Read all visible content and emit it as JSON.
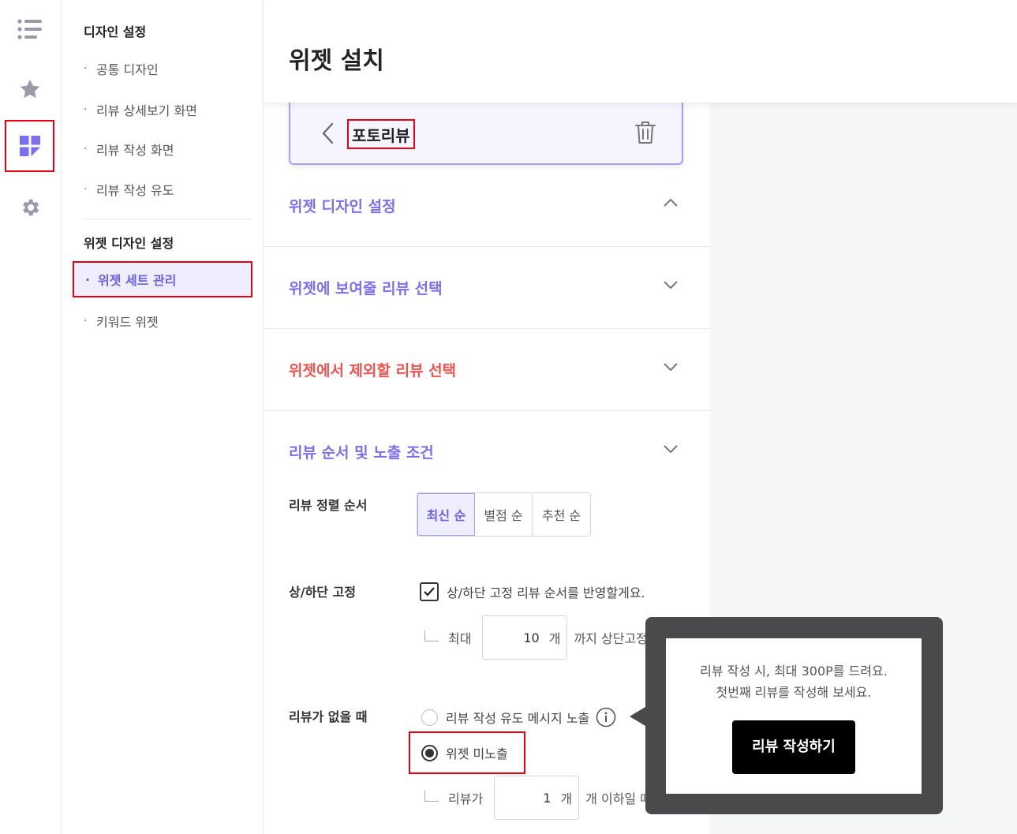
{
  "rail": {
    "icons": [
      "list-icon",
      "star-icon",
      "dashboard-icon",
      "gear-icon"
    ],
    "accent": "#7a6ff0"
  },
  "submenu": {
    "design_heading": "디자인 설정",
    "design_items": [
      "공통 디자인",
      "리뷰 상세보기 화면",
      "리뷰 작성 화면",
      "리뷰 작성 유도"
    ],
    "widget_heading": "위젯 디자인 설정",
    "widget_items": [
      "위젯 세트 관리",
      "키워드 위젯"
    ]
  },
  "header": {
    "title": "위젯 설치"
  },
  "widget_card": {
    "name": "포토리뷰"
  },
  "sections": [
    {
      "title": "위젯 디자인 설정",
      "expanded": true
    },
    {
      "title": "위젯에 보여줄 리뷰 선택",
      "expanded": false
    },
    {
      "title": "위젯에서 제외할 리뷰 선택",
      "expanded": false
    },
    {
      "title": "리뷰 순서 및 노출 조건",
      "expanded": false
    }
  ],
  "form": {
    "sort_label": "리뷰 정렬 순서",
    "sort_options": [
      "최신 순",
      "별점 순",
      "추천 순"
    ],
    "sort_selected": "최신 순",
    "pin_label": "상/하단 고정",
    "pin_checkbox_label": "상/하단 고정 리뷰 순서를 반영할게요.",
    "pin_checked": true,
    "pin_max_prefix": "최대",
    "pin_max_value": "10",
    "pin_max_unit": "개",
    "pin_max_suffix": "까지 상단고정",
    "empty_label": "리뷰가 없을 때",
    "empty_options": [
      "리뷰 작성 유도 메시지 노출",
      "위젯 미노출"
    ],
    "empty_selected": "위젯 미노출",
    "min_prefix": "리뷰가",
    "min_value": "1",
    "min_unit": "개",
    "min_suffix": "개 이하일 때"
  },
  "popup": {
    "message_line1": "리뷰 작성 시, 최대 300P를 드려요.",
    "message_line2": "첫번째 리뷰를 작성해 보세요.",
    "button": "리뷰 작성하기"
  }
}
